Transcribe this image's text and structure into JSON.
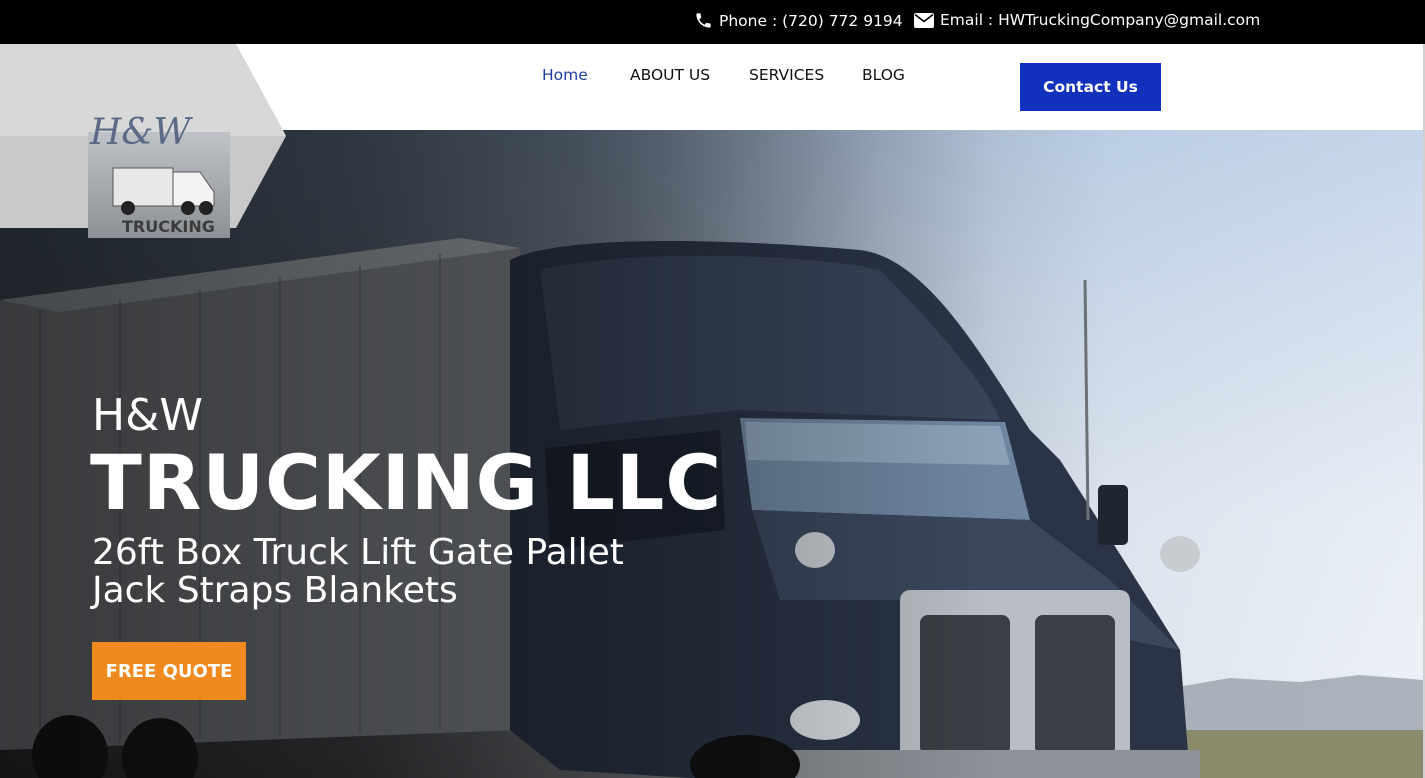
{
  "topbar": {
    "phone_icon": "phone-icon",
    "phone_text": "Phone : (720) 772 9194",
    "email_icon": "envelope-icon",
    "email_text": "Email : HWTruckingCompany@gmail.com"
  },
  "logo": {
    "script_text": "H&W",
    "wordmark": "TRUCKING"
  },
  "nav": {
    "items": [
      {
        "label": "Home",
        "active": true
      },
      {
        "label": "ABOUT US",
        "active": false
      },
      {
        "label": "SERVICES",
        "active": false
      },
      {
        "label": "BLOG",
        "active": false
      }
    ],
    "contact_label": "Contact Us"
  },
  "hero": {
    "line1": "H&W",
    "line2": "TRUCKING LLC",
    "subtitle": "26ft Box Truck Lift Gate Pallet Jack Straps Blankets",
    "cta_label": "FREE QUOTE"
  },
  "colors": {
    "topbar_bg": "#000000",
    "brand_blue": "#1131bd",
    "active_nav": "#1f3fa8",
    "cta_orange": "#f18a1e"
  }
}
